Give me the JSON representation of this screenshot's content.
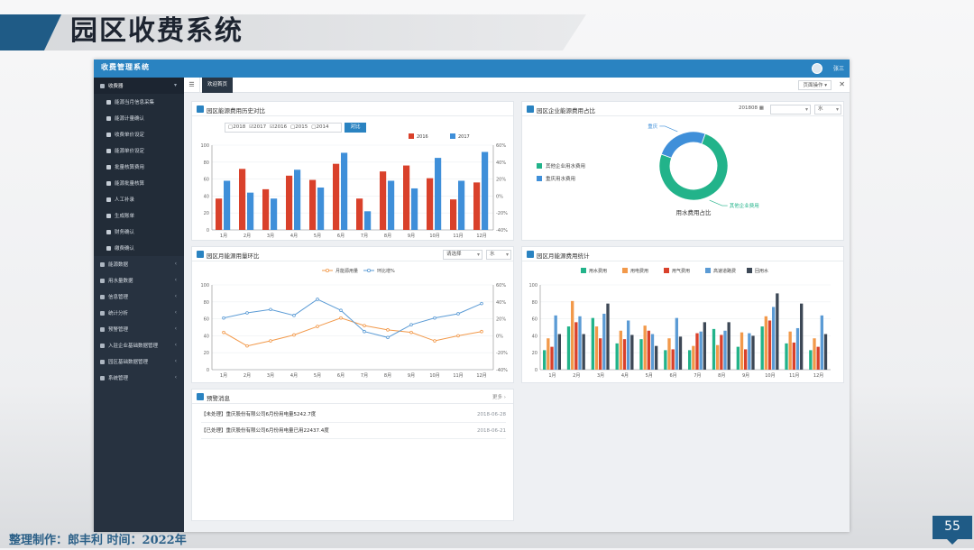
{
  "slide": {
    "title": "园区收费系统",
    "footer": "整理制作：郎丰利 时间：2022年",
    "page_number": "55",
    "accent_color": "#1f5b86"
  },
  "app": {
    "title": "收费管理系统",
    "user": "张三",
    "sidebar": [
      {
        "label": "收费器",
        "type": "head",
        "icon": "coin-icon"
      },
      {
        "label": "能源当月信息采集",
        "type": "sub",
        "icon": "list-icon"
      },
      {
        "label": "能源计量确认",
        "type": "sub",
        "icon": "gear-icon"
      },
      {
        "label": "收费单价设定",
        "type": "sub",
        "icon": "calendar-icon"
      },
      {
        "label": "能源单价设定",
        "type": "sub",
        "icon": "document-icon"
      },
      {
        "label": "批量核算费用",
        "type": "sub",
        "icon": "gear-icon"
      },
      {
        "label": "能源批量核算",
        "type": "sub",
        "icon": "gear-icon"
      },
      {
        "label": "人工补录",
        "type": "sub",
        "icon": "list-icon"
      },
      {
        "label": "生成账单",
        "type": "sub",
        "icon": "document-icon"
      },
      {
        "label": "财务确认",
        "type": "sub",
        "icon": "check-icon"
      },
      {
        "label": "缴费确认",
        "type": "sub",
        "icon": "gear-icon"
      },
      {
        "label": "能源数据",
        "type": "main",
        "icon": "grid-icon"
      },
      {
        "label": "用水量数据",
        "type": "main",
        "icon": "user-icon"
      },
      {
        "label": "信息管理",
        "type": "main",
        "icon": "book-icon"
      },
      {
        "label": "统计分析",
        "type": "main",
        "icon": "chart-icon"
      },
      {
        "label": "预警管理",
        "type": "main",
        "icon": "bell-icon"
      },
      {
        "label": "入驻企业基础数据管理",
        "type": "main",
        "icon": "user-icon"
      },
      {
        "label": "园区基础数据管理",
        "type": "main",
        "icon": "grid-icon"
      },
      {
        "label": "系统管理",
        "type": "main",
        "icon": "monitor-icon"
      }
    ],
    "tabs": {
      "active": "欢迎首页",
      "ops": "页面操作 ▾"
    }
  },
  "panels": {
    "history": {
      "title": "园区能源费用历史对比",
      "years": [
        "2018",
        "2017",
        "2016",
        "2015",
        "2014"
      ],
      "compare_button": "对比"
    },
    "share": {
      "title": "园区企业能源费用占比",
      "period": "201808",
      "type": "水"
    },
    "monthly": {
      "title": "园区月能源用量环比",
      "select1": "请选择",
      "select2": "水"
    },
    "stats": {
      "title": "园区月能源费用统计"
    },
    "alerts": {
      "title": "预警消息",
      "more": "更多 ›",
      "items": [
        {
          "text": "【未处理】重庆股份有限公司6月份用电量5242.7度",
          "date": "2018-06-28"
        },
        {
          "text": "【已处理】重庆股份有限公司6月份用电量已用22437.4度",
          "date": "2018-06-21"
        }
      ]
    }
  },
  "chart_data": [
    {
      "type": "bar",
      "title": "园区能源费用历史对比",
      "categories": [
        "1月",
        "2月",
        "3月",
        "4月",
        "5月",
        "6月",
        "7月",
        "8月",
        "9月",
        "10月",
        "11月",
        "12月"
      ],
      "series": [
        {
          "name": "2016",
          "color": "#d9412b",
          "values": [
            37,
            72,
            48,
            64,
            59,
            78,
            37,
            69,
            76,
            61,
            36,
            56
          ]
        },
        {
          "name": "2017",
          "color": "#3f8fd9",
          "values": [
            58,
            44,
            37,
            71,
            50,
            91,
            22,
            58,
            49,
            85,
            58,
            92
          ]
        }
      ],
      "ylim": [
        0,
        100
      ],
      "yticks": [
        0,
        20,
        40,
        60,
        80,
        100
      ],
      "y2ticks": [
        "60%",
        "40%",
        "20%",
        "0%",
        "-20%",
        "-40%"
      ],
      "legend": "top-right"
    },
    {
      "type": "pie",
      "title": "用水费用占比",
      "labels": [
        "其他企业用水费用",
        "重庆用水费用"
      ],
      "slice_labels": [
        "其他企业费用",
        "重庆"
      ],
      "values": [
        75,
        25
      ],
      "colors": [
        "#22b38a",
        "#3f8fd9"
      ],
      "legend": "left"
    },
    {
      "type": "line",
      "title": "园区月能源用量环比",
      "categories": [
        "1月",
        "2月",
        "3月",
        "4月",
        "5月",
        "6月",
        "7月",
        "8月",
        "9月",
        "10月",
        "11月",
        "12月"
      ],
      "series": [
        {
          "name": "月能源用量",
          "color": "#f2994a",
          "values": [
            44,
            28,
            34,
            41,
            51,
            61,
            52,
            47,
            44,
            34,
            40,
            45
          ]
        },
        {
          "name": "环比增%",
          "color": "#5b9bd5",
          "values": [
            61,
            67,
            71,
            64,
            83,
            70,
            45,
            38,
            53,
            61,
            66,
            78
          ]
        }
      ],
      "ylim": [
        0,
        100
      ],
      "yticks": [
        0,
        20,
        40,
        60,
        80,
        100
      ],
      "y2ticks": [
        "60%",
        "40%",
        "20%",
        "0%",
        "-20%",
        "-40%"
      ],
      "legend": "top"
    },
    {
      "type": "bar",
      "title": "园区月能源费用统计",
      "categories": [
        "1月",
        "2月",
        "3月",
        "4月",
        "5月",
        "6月",
        "7月",
        "8月",
        "9月",
        "10月",
        "11月",
        "12月"
      ],
      "series": [
        {
          "name": "用水费用",
          "color": "#22b38a",
          "values": [
            23,
            51,
            61,
            31,
            36,
            23,
            23,
            48,
            27,
            51,
            31,
            23
          ]
        },
        {
          "name": "用电费用",
          "color": "#f2994a",
          "values": [
            37,
            81,
            51,
            46,
            52,
            37,
            28,
            29,
            44,
            63,
            45,
            37
          ]
        },
        {
          "name": "用气费用",
          "color": "#d9412b",
          "values": [
            27,
            56,
            37,
            36,
            46,
            24,
            43,
            41,
            24,
            58,
            32,
            27
          ]
        },
        {
          "name": "高速道路费",
          "color": "#5b9bd5",
          "values": [
            64,
            63,
            66,
            58,
            42,
            61,
            45,
            46,
            43,
            74,
            49,
            64
          ]
        },
        {
          "name": "回用水",
          "color": "#3d4856",
          "values": [
            42,
            42,
            78,
            41,
            28,
            39,
            56,
            56,
            40,
            90,
            78,
            42
          ]
        }
      ],
      "ylim": [
        0,
        100
      ],
      "yticks": [
        0,
        20,
        40,
        60,
        80,
        100
      ],
      "legend": "top"
    }
  ]
}
